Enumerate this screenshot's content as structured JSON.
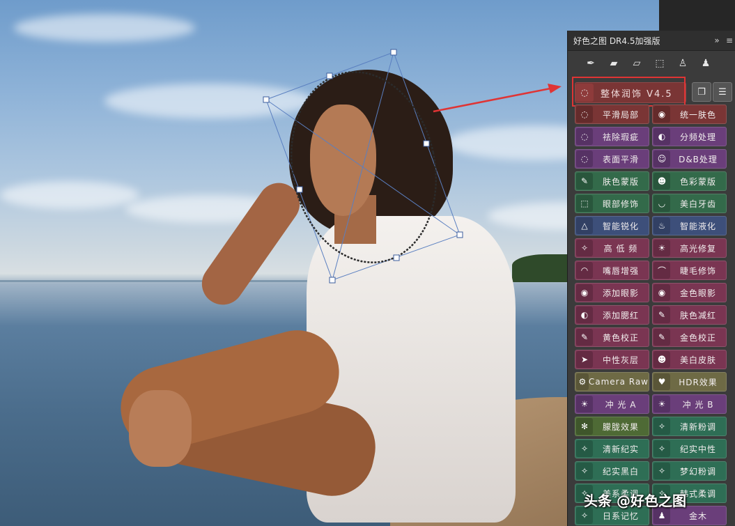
{
  "panel": {
    "title": "好色之图 DR4.5加强版",
    "header_icons": [
      "double-chevron-right-icon",
      "menu-icon"
    ],
    "toolbar_icons": [
      "eyedropper-brush-icon",
      "bandage-icon",
      "bandage-2-icon",
      "dotted-square-icon",
      "stamp-icon",
      "stamp-2-icon"
    ],
    "main_label": "整体润饰 V4.5"
  },
  "buttons": [
    {
      "label": "平滑局部",
      "icon": "lasso-icon",
      "color": "#7a3535"
    },
    {
      "label": "统一肤色",
      "icon": "eye-swirl-icon",
      "color": "#7a3535"
    },
    {
      "label": "祛除瑕疵",
      "icon": "lasso-icon",
      "color": "#6a3e7a"
    },
    {
      "label": "分频处理",
      "icon": "split-circle-icon",
      "color": "#6a3e7a"
    },
    {
      "label": "表面平滑",
      "icon": "lasso-icon",
      "color": "#6a3e7a"
    },
    {
      "label": "D&B处理",
      "icon": "face-icon",
      "color": "#6a3e7a"
    },
    {
      "label": "肤色蒙版",
      "icon": "eyedropper-icon",
      "color": "#336a4a"
    },
    {
      "label": "色彩蒙版",
      "icon": "mask-icon",
      "color": "#336a4a"
    },
    {
      "label": "眼部修饰",
      "icon": "dotted-square-icon",
      "color": "#336a4a"
    },
    {
      "label": "美白牙齿",
      "icon": "smile-icon",
      "color": "#336a4a"
    },
    {
      "label": "智能锐化",
      "icon": "triangle-icon",
      "color": "#3d4f7a"
    },
    {
      "label": "智能液化",
      "icon": "flame-icon",
      "color": "#3d4f7a"
    },
    {
      "label": "高 低 频",
      "icon": "wand-icon",
      "color": "#7a3552"
    },
    {
      "label": "高光修复",
      "icon": "sun-icon",
      "color": "#7a3552"
    },
    {
      "label": "嘴唇增强",
      "icon": "lips-icon",
      "color": "#7a3552"
    },
    {
      "label": "睫毛修饰",
      "icon": "eyelash-icon",
      "color": "#7a3552"
    },
    {
      "label": "添加眼影",
      "icon": "eye-icon",
      "color": "#7a3552"
    },
    {
      "label": "金色眼影",
      "icon": "eye-icon",
      "color": "#7a3552"
    },
    {
      "label": "添加腮红",
      "icon": "split-circle-icon",
      "color": "#7a3552"
    },
    {
      "label": "肤色减红",
      "icon": "eyedropper-icon",
      "color": "#7a3552"
    },
    {
      "label": "黄色校正",
      "icon": "eyedropper-icon",
      "color": "#7a3552"
    },
    {
      "label": "金色校正",
      "icon": "eyedropper-icon",
      "color": "#7a3552"
    },
    {
      "label": "中性灰层",
      "icon": "cursor-icon",
      "color": "#7a3552"
    },
    {
      "label": "美白皮肤",
      "icon": "mask-icon",
      "color": "#7a3552"
    },
    {
      "label": "Camera Raw",
      "icon": "gear-icon",
      "color": "#6e6a45"
    },
    {
      "label": "HDR效果",
      "icon": "heart-icon",
      "color": "#6e6a45"
    },
    {
      "label": "冲 光 A",
      "icon": "sun-icon",
      "color": "#6a3e7a"
    },
    {
      "label": "冲 光 B",
      "icon": "sun-icon",
      "color": "#6a3e7a"
    },
    {
      "label": "朦胧效果",
      "icon": "snowflake-icon",
      "color": "#4e6a35"
    },
    {
      "label": "清新粉调",
      "icon": "wand-icon",
      "color": "#2e6e55"
    },
    {
      "label": "清新纪实",
      "icon": "wand-icon",
      "color": "#2e6e55"
    },
    {
      "label": "纪实中性",
      "icon": "wand-icon",
      "color": "#2e6e55"
    },
    {
      "label": "纪实黑白",
      "icon": "wand-icon",
      "color": "#2e6e55"
    },
    {
      "label": "梦幻粉调",
      "icon": "wand-icon",
      "color": "#2e6e55"
    },
    {
      "label": "美系柔调",
      "icon": "wand-icon",
      "color": "#2e6e55"
    },
    {
      "label": "韩式柔调",
      "icon": "wand-icon",
      "color": "#2e6e55"
    },
    {
      "label": "日系记忆",
      "icon": "wand-icon",
      "color": "#2e6e55"
    },
    {
      "label": "金木",
      "icon": "people-icon",
      "color": "#6a3e7a"
    }
  ],
  "watermark": "头条 @好色之图",
  "colors": {
    "highlight": "#e03434",
    "arrow": "#e03434"
  }
}
